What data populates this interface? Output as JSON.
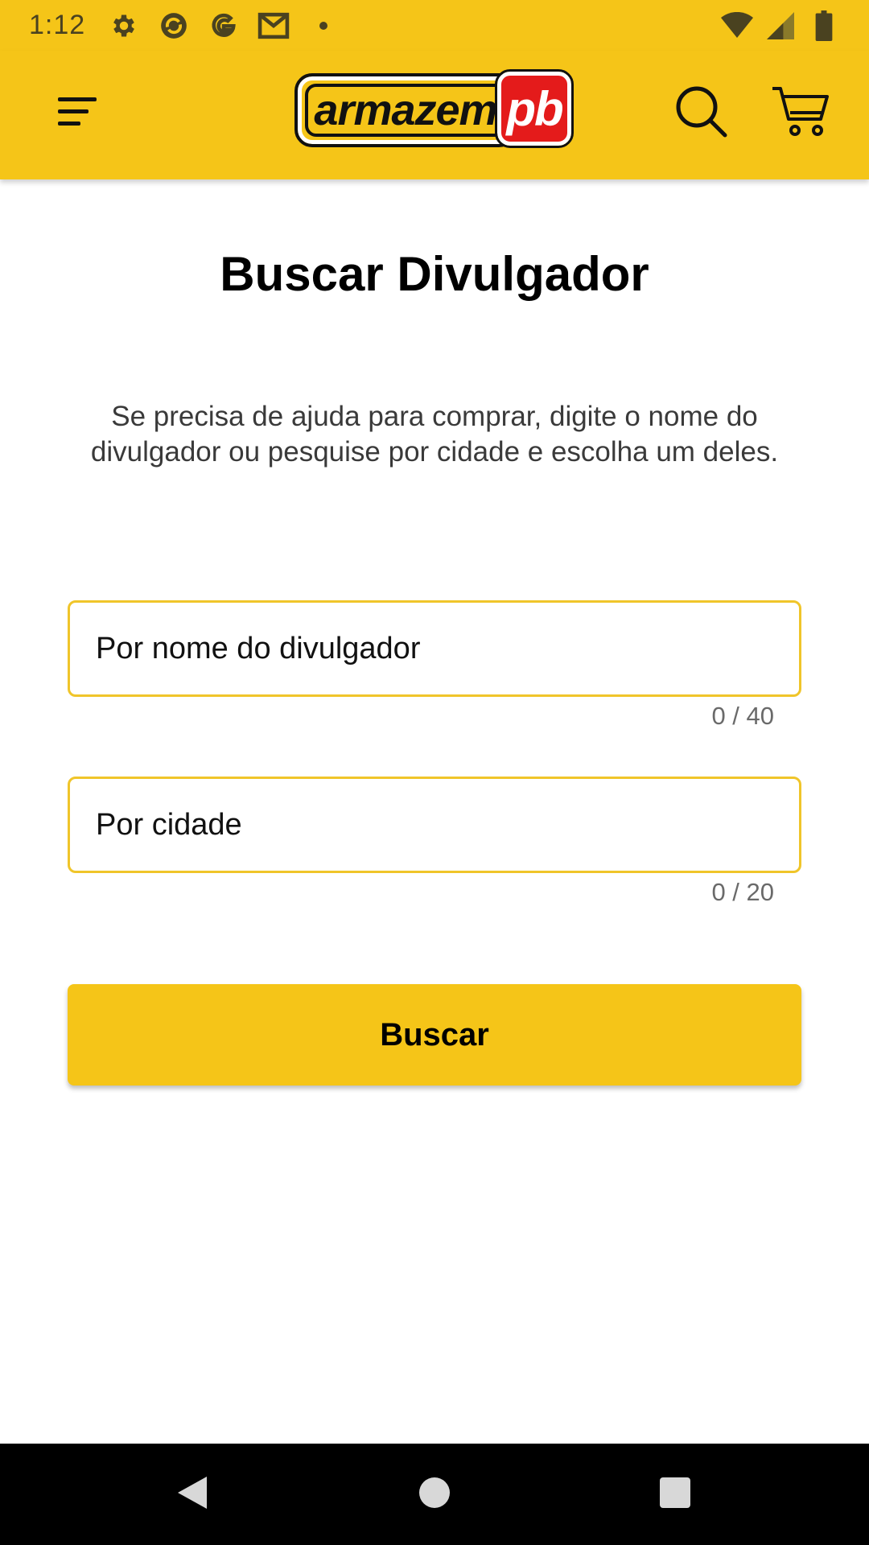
{
  "status_bar": {
    "time": "1:12",
    "left_icons": [
      "gear-icon",
      "sync-icon",
      "google-icon",
      "gmail-icon",
      "dot-icon"
    ],
    "right_icons": [
      "wifi-icon",
      "signal-icon",
      "battery-icon"
    ]
  },
  "app_bar": {
    "background": "#F5C518",
    "logo": {
      "left_text": "armazem",
      "right_text": "pb",
      "accent": "#E41B1B"
    },
    "icons": [
      "menu-icon",
      "search-icon",
      "cart-icon"
    ]
  },
  "page": {
    "title": "Buscar Divulgador",
    "description": "Se precisa de ajuda para comprar, digite o nome do divulgador ou pesquise por cidade e escolha um deles."
  },
  "form": {
    "name_field": {
      "placeholder": "Por nome do divulgador",
      "value": "",
      "counter": "0 / 40"
    },
    "city_field": {
      "placeholder": "Por cidade",
      "value": "",
      "counter": "0 / 20"
    },
    "submit_label": "Buscar",
    "field_border_color": "#F0C52A"
  },
  "nav_bar": {
    "icons": [
      "back-icon",
      "home-icon",
      "recents-icon"
    ]
  }
}
